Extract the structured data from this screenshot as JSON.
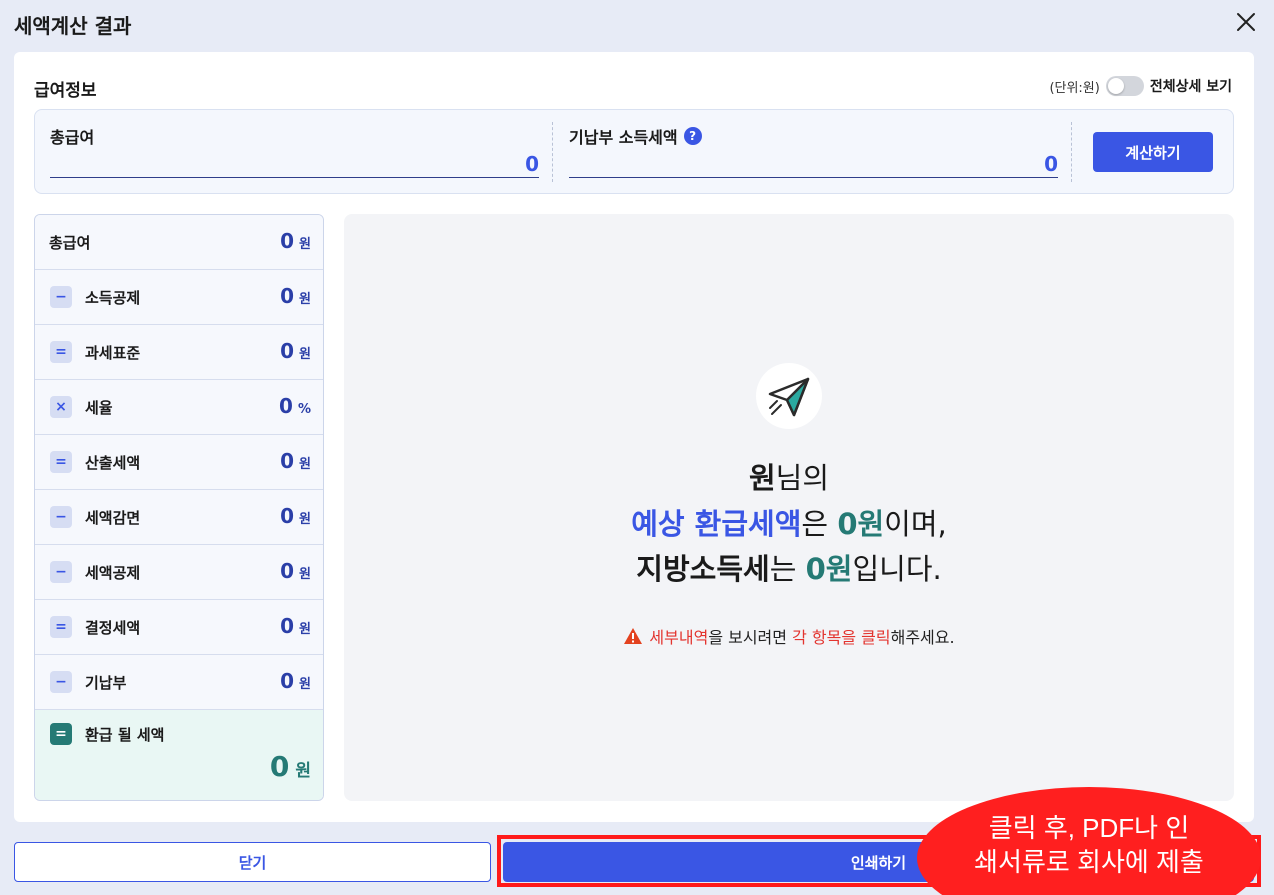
{
  "header": {
    "title": "세액계산 결과"
  },
  "info": {
    "section_title": "급여정보",
    "unit": "(단위:원)",
    "toggle_label": "전체상세 보기",
    "toggle_on": false,
    "total_salary_label": "총급여",
    "total_salary_value": "0",
    "prepaid_tax_label": "기납부 소득세액",
    "help_glyph": "?",
    "prepaid_tax_value": "0",
    "calc_button": "계산하기"
  },
  "breakdown": [
    {
      "op": "",
      "label": "총급여",
      "value": "0",
      "unit": "원"
    },
    {
      "op": "−",
      "label": "소득공제",
      "value": "0",
      "unit": "원"
    },
    {
      "op": "=",
      "label": "과세표준",
      "value": "0",
      "unit": "원"
    },
    {
      "op": "×",
      "label": "세율",
      "value": "0",
      "unit": "%"
    },
    {
      "op": "=",
      "label": "산출세액",
      "value": "0",
      "unit": "원"
    },
    {
      "op": "−",
      "label": "세액감면",
      "value": "0",
      "unit": "원"
    },
    {
      "op": "−",
      "label": "세액공제",
      "value": "0",
      "unit": "원"
    },
    {
      "op": "=",
      "label": "결정세액",
      "value": "0",
      "unit": "원"
    },
    {
      "op": "−",
      "label": "기납부",
      "value": "0",
      "unit": "원"
    }
  ],
  "final": {
    "op": "=",
    "label": "환급 될 세액",
    "value": "0",
    "unit": "원"
  },
  "result": {
    "line1_name": "원",
    "line1_suffix": "님의",
    "line2_part1": "예상 환급세액",
    "line2_part2": "은 ",
    "line2_amount": "0원",
    "line2_part3": "이며,",
    "line3_part1": "지방소득세",
    "line3_part2": "는 ",
    "line3_amount": "0원",
    "line3_part3": "입니다.",
    "notice_part1": "세부내역",
    "notice_part2": "을 보시려면 ",
    "notice_part3": "각 항목을 클릭",
    "notice_part4": "해주세요."
  },
  "footer": {
    "close_button": "닫기",
    "print_button": "인쇄하기"
  },
  "callout": {
    "line1": "클릭 후, PDF나 인",
    "line2": "쇄서류로 회사에 제출"
  },
  "colors": {
    "primary": "#3a56e4",
    "teal": "#257a75",
    "red": "#e3342f",
    "background": "#e7ebf6"
  },
  "icons": {
    "close": "close-icon",
    "help": "help-icon",
    "plane": "paper-plane-icon",
    "warning": "warning-icon"
  }
}
